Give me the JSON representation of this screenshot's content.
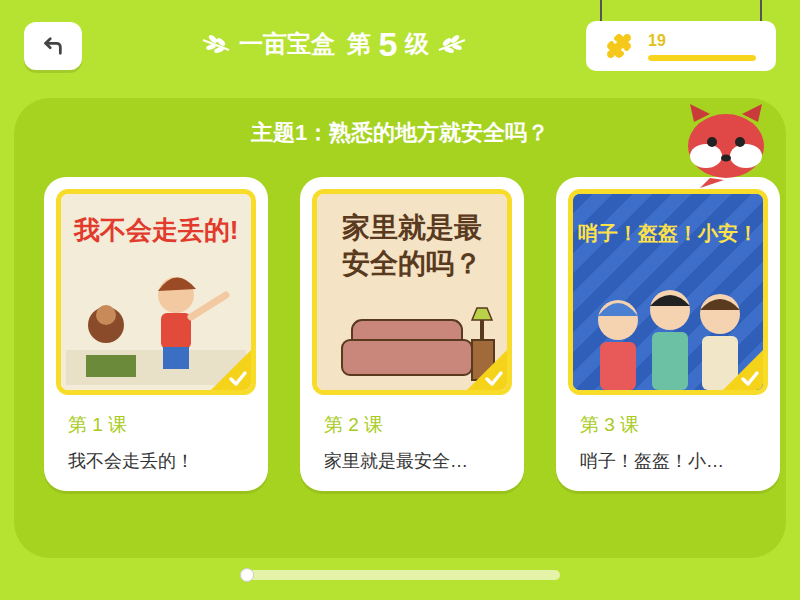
{
  "header": {
    "back_button": "↰",
    "title": {
      "brand": "一亩宝盒",
      "prefix": "第",
      "level": "5",
      "suffix": "级"
    },
    "score": {
      "value": "19",
      "level": 1.0
    }
  },
  "theme": {
    "title": "主题1：熟悉的地方就安全吗？"
  },
  "lessons": [
    {
      "number": "第 1 课",
      "title": "我不会走丢的！",
      "completed": true,
      "cover": {
        "kind": "boy",
        "title": "我不会走丢的!",
        "color": "#f3ecd9"
      }
    },
    {
      "number": "第 2 课",
      "title": "家里就是最安全…",
      "completed": true,
      "cover": {
        "kind": "sofa",
        "title": "家里就是最安全的吗？",
        "color": "#f4e3c4"
      }
    },
    {
      "number": "第 3 课",
      "title": "哨子！盔盔！小…",
      "completed": true,
      "cover": {
        "kind": "kids",
        "title": "哨子！盔盔！小安！",
        "color": "#2f5fb8"
      }
    }
  ],
  "scroll": {
    "level": 0
  }
}
